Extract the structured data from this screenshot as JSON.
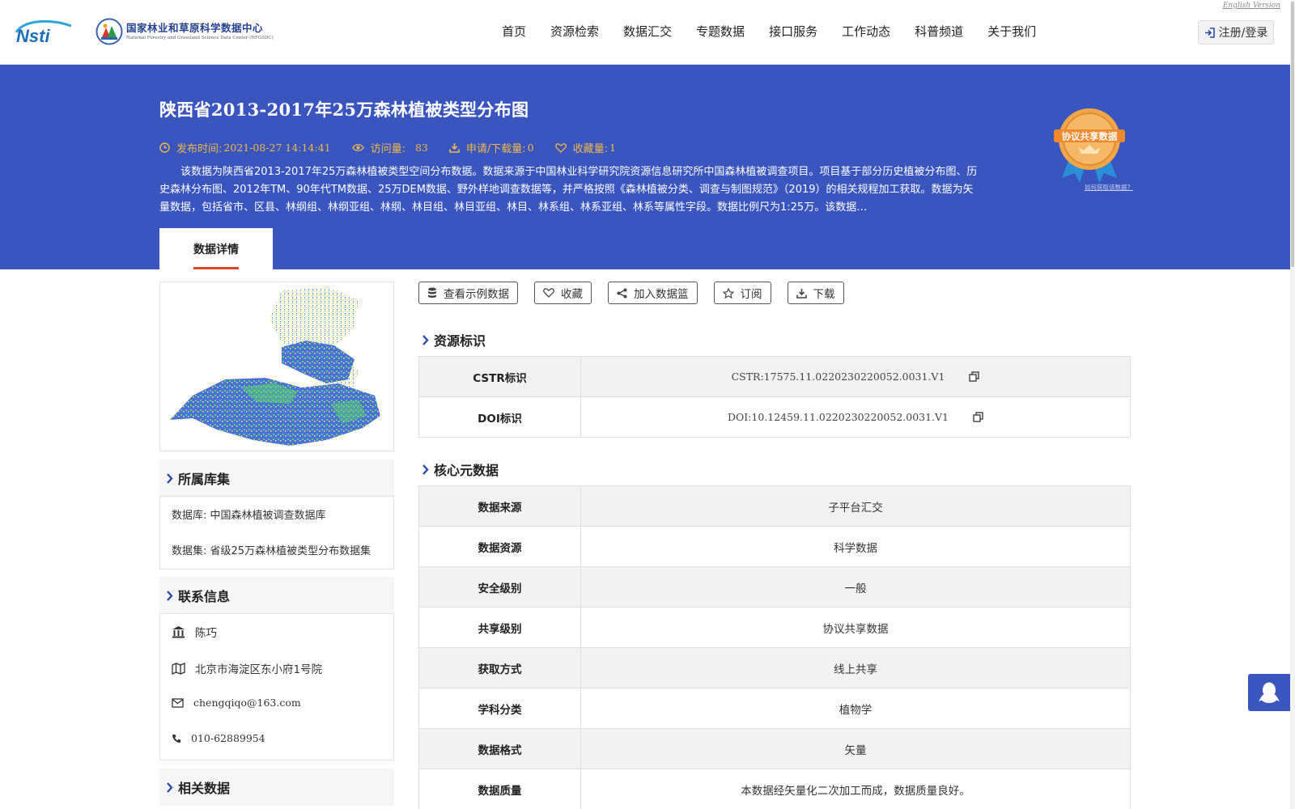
{
  "header": {
    "english_link": "English Version",
    "logo_text": "Nsti",
    "org_name_cn": "国家林业和草原科学数据中心",
    "org_name_en": "National Forestry and Grassland Science Data Center (NFGSDC)",
    "nav": [
      "首页",
      "资源检索",
      "数据汇交",
      "专题数据",
      "接口服务",
      "工作动态",
      "科普频道",
      "关于我们"
    ],
    "login_label": "注册/登录"
  },
  "hero": {
    "title": "陕西省2013-2017年25万森林植被类型分布图",
    "publish_label": "发布时间:",
    "publish_value": "2021-08-27 14:14:41",
    "visits_label": "访问量:",
    "visits_value": "83",
    "downloads_label": "申请/下载量:",
    "downloads_value": "0",
    "favorites_label": "收藏量:",
    "favorites_value": "1",
    "description": "该数据为陕西省2013-2017年25万森林植被类型空间分布数据。数据来源于中国林业科学研究院资源信息研究所中国森林植被调查项目。项目基于部分历史植被分布图、历史森林分布图、2012年TM、90年代TM数据、25万DEM数据、野外样地调查数据等，并严格按照《森林植被分类、调查与制图规范》（2019）的相关规程加工获取。数据为矢量数据，包括省市、区县、林纲组、林纲亚组、林纲、林目组、林目亚组、林目、林系组、林系亚组、林系等属性字段。数据比例尺为1:25万。该数据…",
    "award_label": "协议共享数据",
    "award_link": "如何获取该数据？",
    "tab_label": "数据详情"
  },
  "left": {
    "collection_title": "所属库集",
    "database_label": "数据库:",
    "database_value": "中国森林植被调查数据库",
    "dataset_label": "数据集:",
    "dataset_value": "省级25万森林植被类型分布数据集",
    "contact_title": "联系信息",
    "contact_name": "陈巧",
    "contact_address": "北京市海淀区东小府1号院",
    "contact_email": "chengqiqo@163.com",
    "contact_phone": "010-62889954",
    "related_title": "相关数据"
  },
  "actions": [
    "查看示例数据",
    "收藏",
    "加入数据篮",
    "订阅",
    "下载"
  ],
  "identifiers": {
    "title": "资源标识",
    "rows": [
      {
        "key": "CSTR标识",
        "value": "CSTR:17575.11.0220230220052.0031.V1"
      },
      {
        "key": "DOI标识",
        "value": "DOI:10.12459.11.0220230220052.0031.V1"
      }
    ]
  },
  "core": {
    "title": "核心元数据",
    "rows": [
      {
        "key": "数据来源",
        "value": "子平台汇交"
      },
      {
        "key": "数据资源",
        "value": "科学数据"
      },
      {
        "key": "安全级别",
        "value": "一般"
      },
      {
        "key": "共享级别",
        "value": "协议共享数据"
      },
      {
        "key": "获取方式",
        "value": "线上共享"
      },
      {
        "key": "学科分类",
        "value": "植物学"
      },
      {
        "key": "数据格式",
        "value": "矢量"
      },
      {
        "key": "数据质量",
        "value": "本数据经矢量化二次加工而成，数据质量良好。"
      }
    ]
  },
  "colors": {
    "hero_bg": "#3a55bd",
    "meta_accent": "#f0b84a",
    "tab_underline": "#e1452a",
    "heading_chevron": "#2b4aa8"
  }
}
